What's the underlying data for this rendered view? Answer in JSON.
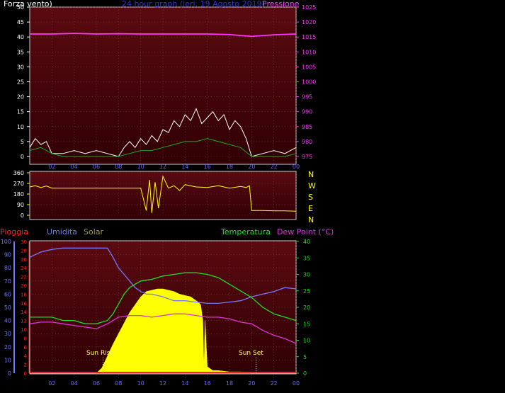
{
  "colors": {
    "background": "#000000",
    "plot_bg_top": "#5a0a0a",
    "plot_bg_bottom": "#3a0000",
    "grid": "#7a4a4a",
    "wind": "#ffffff",
    "gust": "#22aa22",
    "pressure": "#ff33ff",
    "direction": "#ffff00",
    "rain": "#ff2020",
    "humidity": "#7777ff",
    "solar": "#ffff00",
    "temperature": "#22dd22",
    "dewpoint": "#dd33dd",
    "compass": "#ffff00"
  },
  "header": {
    "left": "Forza vento)",
    "center": "24 hour graph (ieri, 19 Agosto 2019)",
    "right": "Pressione"
  },
  "compass": [
    "N",
    "W",
    "S",
    "E",
    "N"
  ],
  "bottom_labels": {
    "rain": "Pioggia",
    "humidity": "Umidita",
    "solar": "Solar",
    "temperature": "Temperatura",
    "dewpoint": "Dew Point (°C)"
  },
  "annotations": {
    "sunrise": "Sun Rise",
    "sunset": "Sun Set"
  },
  "chart_data": [
    {
      "type": "line",
      "xlabel": "",
      "ylabel": "",
      "x_ticks": [
        "02",
        "04",
        "06",
        "08",
        "10",
        "12",
        "14",
        "16",
        "18",
        "20",
        "22",
        "00"
      ],
      "y_left_ticks": [
        0,
        5,
        10,
        15,
        20,
        25,
        30,
        35,
        40,
        45,
        50
      ],
      "y_right_ticks": [
        975,
        980,
        985,
        990,
        995,
        1000,
        1005,
        1010,
        1015,
        1020,
        1025
      ],
      "ylim_left": [
        0,
        50
      ],
      "ylim_right": [
        975,
        1025
      ],
      "series": [
        {
          "key": "pressure",
          "axis": "right",
          "x": [
            0,
            2,
            4,
            6,
            8,
            10,
            12,
            14,
            16,
            18,
            19,
            20,
            22,
            24
          ],
          "values": [
            1016,
            1016,
            1016.2,
            1016,
            1016.1,
            1016,
            1016,
            1016,
            1016,
            1015.8,
            1015.5,
            1015.2,
            1015.7,
            1016
          ]
        },
        {
          "key": "wind",
          "axis": "left",
          "x": [
            0,
            0.5,
            1,
            1.5,
            2,
            3,
            4,
            5,
            6,
            7,
            8,
            8.5,
            9,
            9.5,
            10,
            10.5,
            11,
            11.5,
            12,
            12.5,
            13,
            13.5,
            14,
            14.5,
            15,
            15.5,
            16,
            16.5,
            17,
            17.5,
            18,
            18.5,
            19,
            19.5,
            20,
            21,
            22,
            23,
            24
          ],
          "values": [
            3,
            6,
            4,
            5,
            1,
            1,
            2,
            1,
            2,
            1,
            0,
            3,
            5,
            3,
            6,
            4,
            7,
            5,
            9,
            8,
            12,
            10,
            14,
            12,
            16,
            11,
            13,
            15,
            12,
            14,
            9,
            12,
            10,
            6,
            0,
            1,
            2,
            1,
            3
          ]
        },
        {
          "key": "gust",
          "axis": "left",
          "x": [
            0,
            1,
            2,
            3,
            4,
            5,
            6,
            7,
            8,
            9,
            10,
            11,
            12,
            13,
            14,
            15,
            16,
            17,
            18,
            19,
            20,
            21,
            22,
            23,
            24
          ],
          "values": [
            2,
            3,
            1,
            0,
            0,
            0,
            0,
            0,
            0,
            1,
            2,
            2,
            3,
            4,
            5,
            5,
            6,
            5,
            4,
            3,
            0,
            0,
            0,
            0,
            1
          ]
        }
      ]
    },
    {
      "type": "line",
      "y_ticks": [
        0,
        90,
        180,
        270,
        360
      ],
      "ylim": [
        0,
        360
      ],
      "x_ticks": [],
      "series": [
        {
          "key": "direction",
          "x": [
            0,
            0.5,
            1,
            1.5,
            2,
            4,
            6,
            8,
            8.5,
            9,
            9.5,
            10,
            10.5,
            10.8,
            11,
            11.3,
            11.6,
            12,
            12.5,
            13,
            13.5,
            14,
            15,
            16,
            17,
            18,
            19,
            19.5,
            19.8,
            20,
            21,
            22,
            23,
            24
          ],
          "values": [
            240,
            250,
            235,
            248,
            230,
            230,
            230,
            230,
            230,
            230,
            230,
            230,
            40,
            300,
            20,
            280,
            60,
            330,
            230,
            250,
            210,
            260,
            240,
            235,
            250,
            230,
            245,
            235,
            250,
            40,
            40,
            38,
            38,
            35
          ]
        }
      ]
    },
    {
      "type": "area",
      "x_ticks": [
        "02",
        "04",
        "06",
        "08",
        "10",
        "12",
        "14",
        "16",
        "18",
        "20",
        "22",
        "00"
      ],
      "y_rain_ticks": [
        0,
        2,
        4,
        6,
        8,
        10,
        12,
        14,
        16,
        18,
        20,
        22,
        24,
        26,
        28,
        30
      ],
      "y_humidity_ticks": [
        0,
        10,
        20,
        30,
        40,
        50,
        60,
        70,
        80,
        90,
        100
      ],
      "y_temp_ticks": [
        0,
        5,
        10,
        15,
        20,
        25,
        30,
        35,
        40
      ],
      "ylim_rain": [
        0,
        30
      ],
      "ylim_humidity": [
        0,
        100
      ],
      "ylim_temp": [
        0,
        40
      ],
      "series": [
        {
          "key": "humidity",
          "axis": "humidity",
          "x": [
            0,
            0.5,
            1,
            2,
            3,
            4,
            5,
            6,
            7,
            7.5,
            8,
            8.5,
            9,
            9.5,
            10,
            10.5,
            11,
            12,
            13,
            14,
            15,
            16,
            17,
            18,
            19,
            20,
            21,
            22,
            23,
            24
          ],
          "values": [
            88,
            90,
            92,
            94,
            95,
            95,
            95,
            95,
            95,
            88,
            80,
            75,
            70,
            65,
            62,
            60,
            60,
            58,
            55,
            55,
            54,
            53,
            53,
            54,
            55,
            58,
            60,
            62,
            65,
            64
          ]
        },
        {
          "key": "temperature",
          "axis": "temp",
          "x": [
            0,
            1,
            2,
            3,
            4,
            5,
            6,
            7,
            7.5,
            8,
            8.5,
            9,
            9.5,
            10,
            11,
            12,
            13,
            14,
            15,
            16,
            17,
            18,
            19,
            20,
            21,
            22,
            23,
            24
          ],
          "values": [
            17,
            17,
            17,
            16,
            16,
            15,
            15,
            16,
            18,
            21,
            24,
            26,
            27,
            28,
            28.5,
            29.5,
            30,
            30.5,
            30.5,
            30,
            29,
            27,
            25,
            23,
            20,
            18,
            17,
            16
          ]
        },
        {
          "key": "dewpoint",
          "axis": "temp",
          "x": [
            0,
            1,
            2,
            3,
            4,
            5,
            6,
            7,
            8,
            9,
            10,
            11,
            12,
            13,
            14,
            15,
            16,
            17,
            18,
            19,
            20,
            21,
            22,
            23,
            24
          ],
          "values": [
            15,
            15.5,
            15.5,
            15,
            14.5,
            14,
            13.5,
            15,
            17,
            17.5,
            17.5,
            17,
            17.5,
            18,
            18,
            17.5,
            17,
            17,
            16.5,
            15.5,
            15,
            13,
            11.5,
            10.5,
            9
          ]
        },
        {
          "key": "solar",
          "axis": "humidity",
          "x": [
            0,
            6,
            6.5,
            7,
            7.5,
            8,
            8.5,
            9,
            9.5,
            10,
            10.5,
            11,
            11.5,
            12,
            12.5,
            13,
            13.5,
            14,
            14.5,
            15,
            15.2,
            15.4,
            15.6,
            15.7,
            15.8,
            16,
            16.5,
            17,
            18,
            19,
            20,
            20.5,
            24
          ],
          "values": [
            0,
            0,
            4,
            13,
            22,
            30,
            38,
            46,
            52,
            58,
            62,
            63,
            64,
            64,
            63,
            62,
            60,
            59,
            58,
            55,
            54,
            52,
            40,
            2,
            40,
            5,
            2,
            2,
            1,
            1,
            0,
            0,
            0
          ]
        },
        {
          "key": "rain",
          "axis": "rain",
          "x": [
            0,
            24
          ],
          "values": [
            0,
            0
          ]
        }
      ],
      "sunrise_hour": 6.6,
      "sunset_hour": 20.4
    }
  ]
}
